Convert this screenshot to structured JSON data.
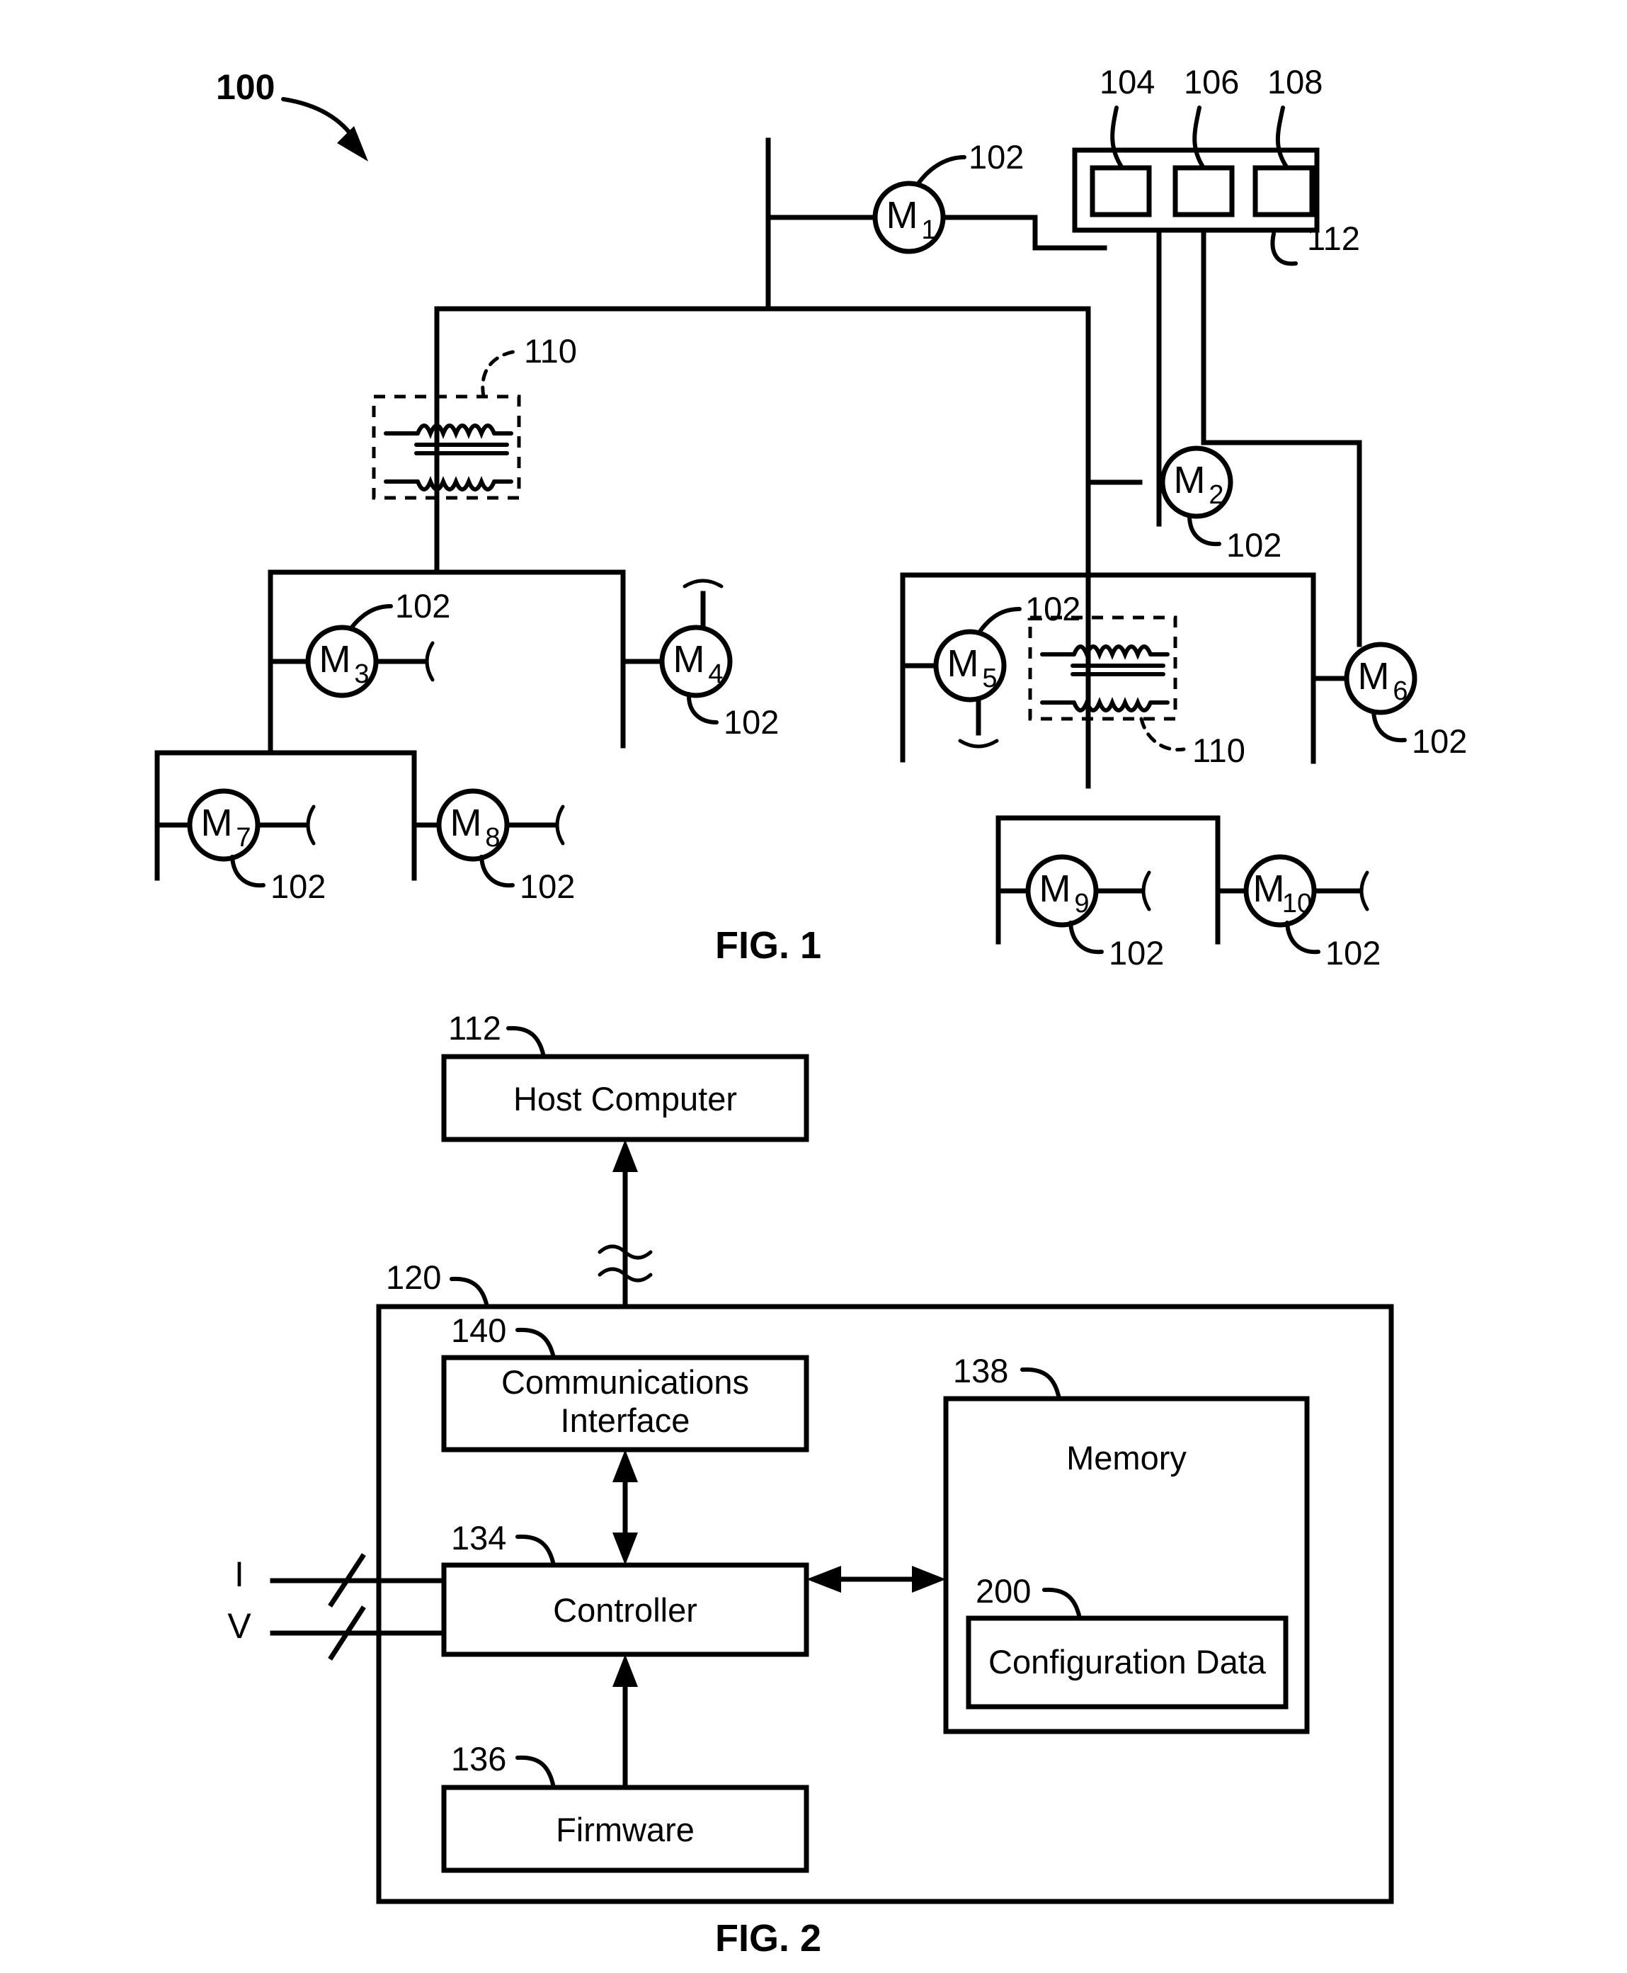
{
  "figures": [
    {
      "id": "fig1",
      "caption": "FIG. 1",
      "system_label": "100",
      "motors": [
        {
          "name": "M",
          "sub": "1",
          "ref": "102"
        },
        {
          "name": "M",
          "sub": "2",
          "ref": "102"
        },
        {
          "name": "M",
          "sub": "3",
          "ref": "102"
        },
        {
          "name": "M",
          "sub": "4",
          "ref": "102"
        },
        {
          "name": "M",
          "sub": "5",
          "ref": "102"
        },
        {
          "name": "M",
          "sub": "6",
          "ref": "102"
        },
        {
          "name": "M",
          "sub": "7",
          "ref": "102"
        },
        {
          "name": "M",
          "sub": "8",
          "ref": "102"
        },
        {
          "name": "M",
          "sub": "9",
          "ref": "102"
        },
        {
          "name": "M",
          "sub": "10",
          "ref": "102"
        }
      ],
      "panel": {
        "ref": "112",
        "module_refs": [
          "104",
          "106",
          "108"
        ]
      },
      "transformer_refs": [
        "110",
        "110"
      ]
    },
    {
      "id": "fig2",
      "caption": "FIG. 2",
      "host": {
        "label": "Host Computer",
        "ref": "112"
      },
      "device": {
        "ref": "120"
      },
      "blocks": [
        {
          "label": "Communications Interface",
          "ref": "140"
        },
        {
          "label": "Controller",
          "ref": "134"
        },
        {
          "label": "Firmware",
          "ref": "136"
        },
        {
          "label": "Memory",
          "ref": "138"
        },
        {
          "label": "Configuration Data",
          "ref": "200"
        }
      ],
      "inputs": [
        {
          "label": "I"
        },
        {
          "label": "V"
        }
      ]
    }
  ],
  "labels": {
    "l100": "100",
    "l102": "102",
    "l104": "104",
    "l106": "106",
    "l108": "108",
    "l110": "110",
    "l112": "112",
    "l120": "120",
    "l134": "134",
    "l136": "136",
    "l138": "138",
    "l140": "140",
    "l200": "200",
    "m1": "M",
    "m1s": "1",
    "m2": "M",
    "m2s": "2",
    "m3": "M",
    "m3s": "3",
    "m4": "M",
    "m4s": "4",
    "m5": "M",
    "m5s": "5",
    "m6": "M",
    "m6s": "6",
    "m7": "M",
    "m7s": "7",
    "m8": "M",
    "m8s": "8",
    "m9": "M",
    "m9s": "9",
    "m10": "M",
    "m10s": "10",
    "fig1": "FIG. 1",
    "fig2": "FIG. 2",
    "host": "Host Computer",
    "comms": "Communications",
    "iface": "Interface",
    "controller": "Controller",
    "firmware": "Firmware",
    "memory": "Memory",
    "configdata": "Configuration Data",
    "inputI": "I",
    "inputV": "V"
  },
  "colors": {
    "ink": "#000000",
    "paper": "#ffffff"
  }
}
